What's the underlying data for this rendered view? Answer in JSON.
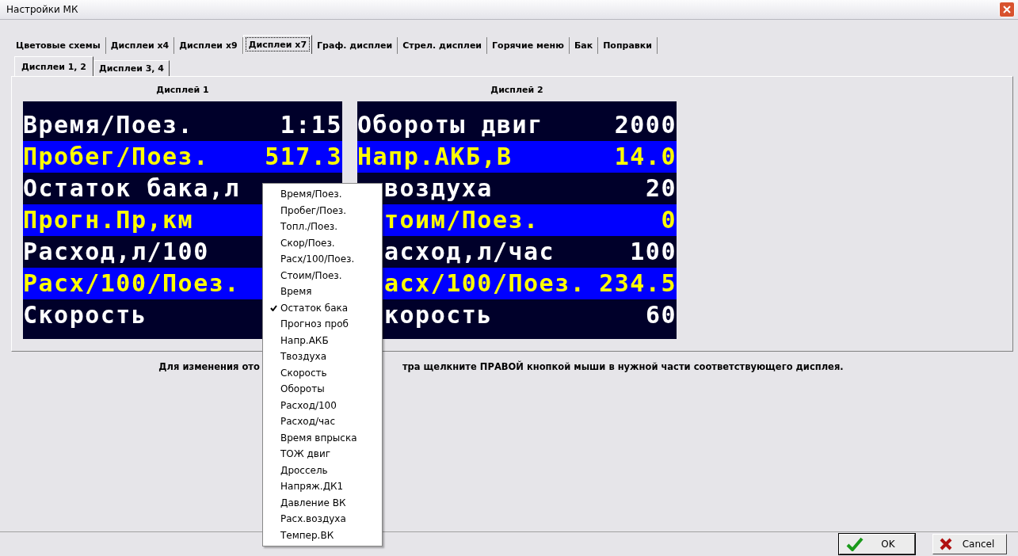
{
  "window": {
    "title": "Настройки МК"
  },
  "tabs": [
    {
      "label": "Цветовые схемы",
      "selected": false
    },
    {
      "label": "Дисплеи x4",
      "selected": false
    },
    {
      "label": "Дисплеи x9",
      "selected": false
    },
    {
      "label": "Дисплеи x7",
      "selected": true
    },
    {
      "label": "Граф. дисплеи",
      "selected": false
    },
    {
      "label": "Стрел. дисплеи",
      "selected": false
    },
    {
      "label": "Горячие меню",
      "selected": false
    },
    {
      "label": "Бак",
      "selected": false
    },
    {
      "label": "Поправки",
      "selected": false
    }
  ],
  "subtabs": [
    {
      "label": "Дисплеи 1, 2",
      "selected": true
    },
    {
      "label": "Дисплеи 3, 4",
      "selected": false
    }
  ],
  "displays": [
    {
      "title": "Дисплей 1",
      "rows": [
        {
          "label": "Время/Поез.",
          "value": "1:15",
          "kind": "plain"
        },
        {
          "label": "Пробег/Поез.",
          "value": "517.3",
          "kind": "highlight"
        },
        {
          "label": "Остаток бака,л",
          "kind": "plain"
        },
        {
          "label": "Прогн.Пр,км",
          "kind": "highlight"
        },
        {
          "label": "Расход,л/100",
          "kind": "plain"
        },
        {
          "label": "Расх/100/Поез.",
          "kind": "highlight"
        },
        {
          "label": "Скорость",
          "kind": "plain"
        }
      ]
    },
    {
      "title": "Дисплей 2",
      "rows": [
        {
          "label": "Обороты двиг",
          "value": "2000",
          "kind": "plain"
        },
        {
          "label": "Напр.АКБ,В",
          "value": "14.0",
          "kind": "highlight"
        },
        {
          "label": "воздуха",
          "value": "20",
          "kind": "plain",
          "clipped": true
        },
        {
          "label": "тоим/Поез.",
          "value": "0",
          "kind": "highlight",
          "clipped": true
        },
        {
          "label": "асход,л/час",
          "value": "100",
          "kind": "plain",
          "clipped": true
        },
        {
          "label": "асх/100/Поез.",
          "value": "234.5",
          "kind": "highlight",
          "clipped": true
        },
        {
          "label": "корость",
          "value": "60",
          "kind": "plain",
          "clipped": true
        }
      ]
    }
  ],
  "hint": {
    "left": "Для изменения ото",
    "right": "тра щелкните ПРАВОЙ кнопкой мыши в нужной части соответствующего дисплея."
  },
  "context_menu": [
    {
      "label": "Время/Поез.",
      "checked": false
    },
    {
      "label": "Пробег/Поез.",
      "checked": false
    },
    {
      "label": "Топл./Поез.",
      "checked": false
    },
    {
      "label": "Скор/Поез.",
      "checked": false
    },
    {
      "label": "Расх/100/Поез.",
      "checked": false
    },
    {
      "label": "Стоим/Поез.",
      "checked": false
    },
    {
      "label": "Время",
      "checked": false
    },
    {
      "label": "Остаток бака",
      "checked": true
    },
    {
      "label": "Прогноз проб",
      "checked": false
    },
    {
      "label": "Напр.АКБ",
      "checked": false
    },
    {
      "label": "Твоздуха",
      "checked": false
    },
    {
      "label": "Скорость",
      "checked": false
    },
    {
      "label": "Обороты",
      "checked": false
    },
    {
      "label": "Расход/100",
      "checked": false
    },
    {
      "label": "Расход/час",
      "checked": false
    },
    {
      "label": "Время впрыска",
      "checked": false
    },
    {
      "label": "ТОЖ двиг",
      "checked": false
    },
    {
      "label": "Дроссель",
      "checked": false
    },
    {
      "label": "Напряж.ДК1",
      "checked": false
    },
    {
      "label": "Давление ВК",
      "checked": false
    },
    {
      "label": "Расх.воздуха",
      "checked": false
    },
    {
      "label": "Темпер.ВК",
      "checked": false
    }
  ],
  "buttons": [
    {
      "label": "OK",
      "kind": "ok"
    },
    {
      "label": "Cancel",
      "kind": "cancel"
    }
  ]
}
